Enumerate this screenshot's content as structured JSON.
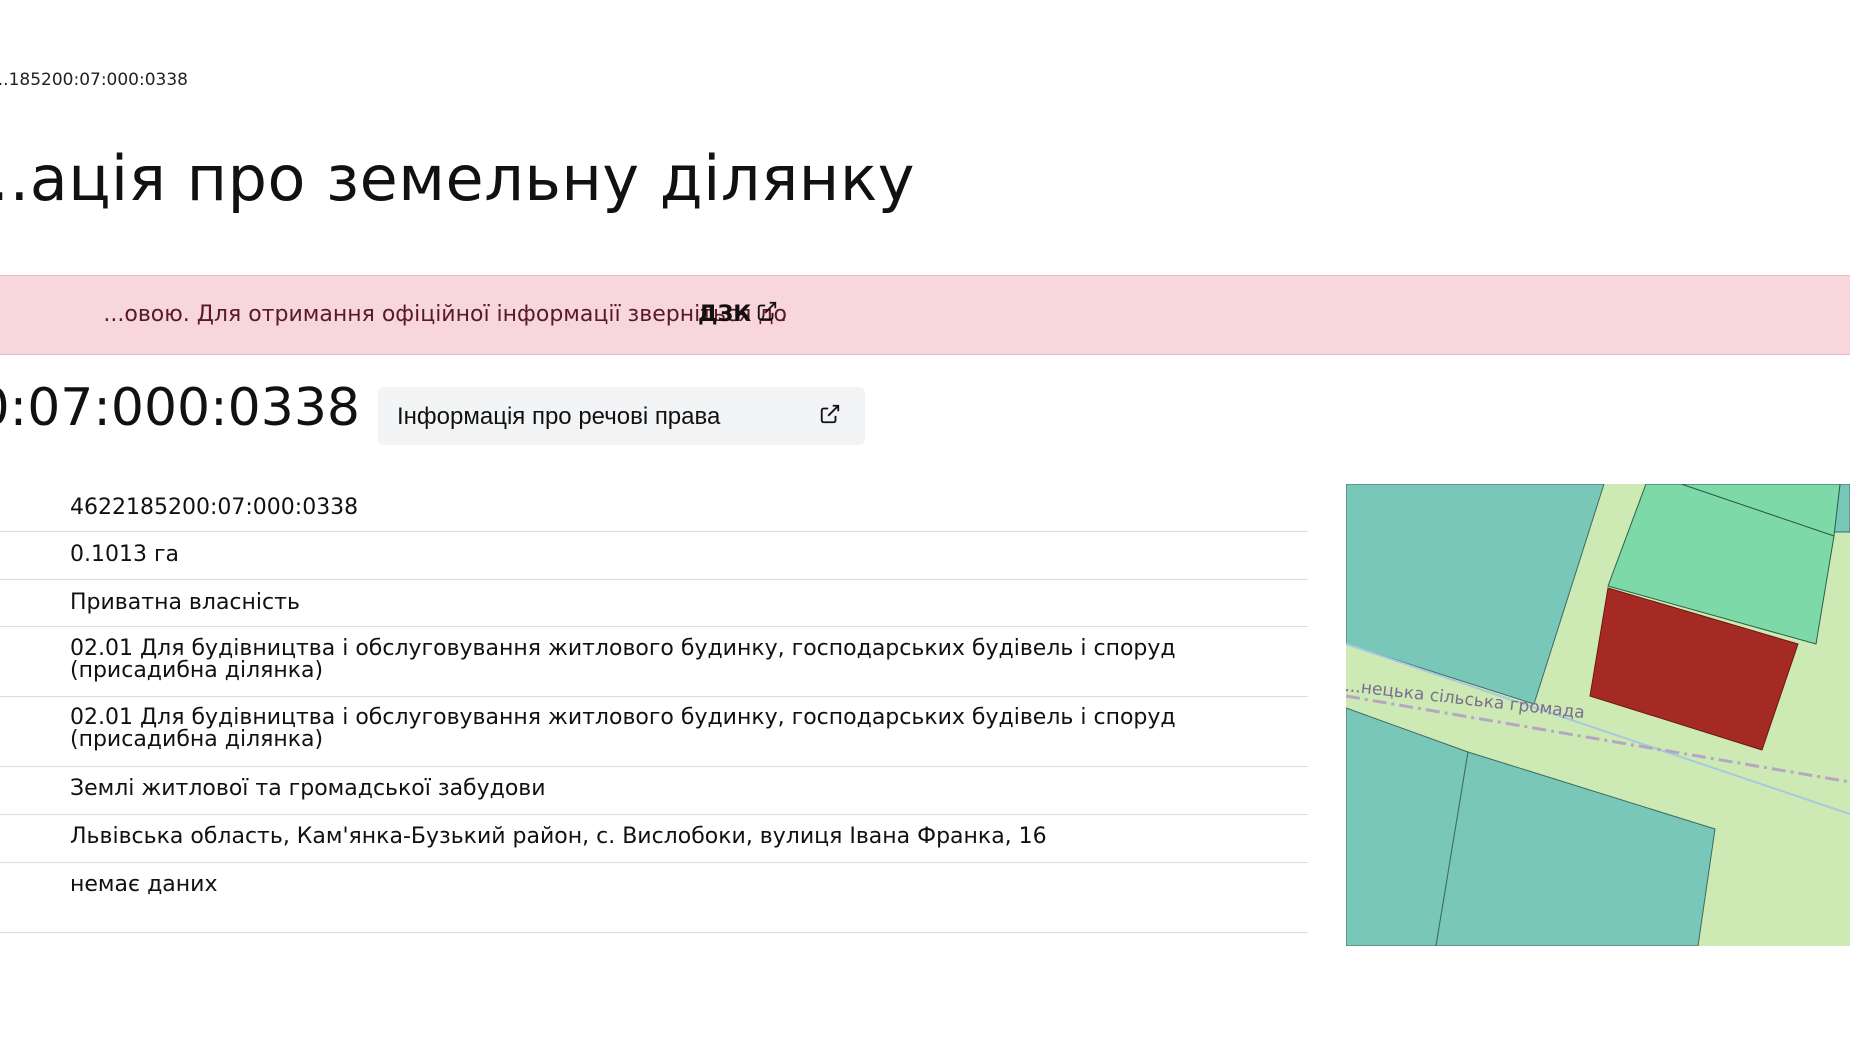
{
  "breadcrumb": "...185200:07:000:0338",
  "page_title": "...ація про земельну ділянку",
  "alert": {
    "text": "...овою. Для отримання офіційної інформації зверніться до",
    "link_label": "ДЗК",
    "end_punctuation": "."
  },
  "parcel_heading": "...0:07:000:0338",
  "rights_button_label": "Інформація про речові права",
  "info_rows": [
    {
      "value": "4622185200:07:000:0338"
    },
    {
      "value": "0.1013 га"
    },
    {
      "value": "Приватна власність"
    },
    {
      "value": "02.01 Для будівництва і обслуговування житлового будинку, господарських будівель і споруд (присадибна ділянка)"
    },
    {
      "value": "02.01 Для будівництва і обслуговування житлового будинку, господарських будівель і споруд (присадибна ділянка)"
    },
    {
      "value": "Землі житлової та громадської забудови"
    },
    {
      "value": "Львівська область, Кам'янка-Бузький район, с. Вислобоки, вулиця Івана Франка, 16"
    },
    {
      "value": "немає даних"
    }
  ],
  "map": {
    "boundary_label": "...нецька сільська громада",
    "colors": {
      "background": "#cde9b4",
      "teal_parcel": "#79c7b9",
      "green_parcel": "#7dd9a8",
      "selected_parcel": "#a52a24",
      "road_line": "#a8c8e0",
      "boundary_line": "#b7a6c2"
    }
  },
  "icons": {
    "external_link": "external-link-icon"
  }
}
